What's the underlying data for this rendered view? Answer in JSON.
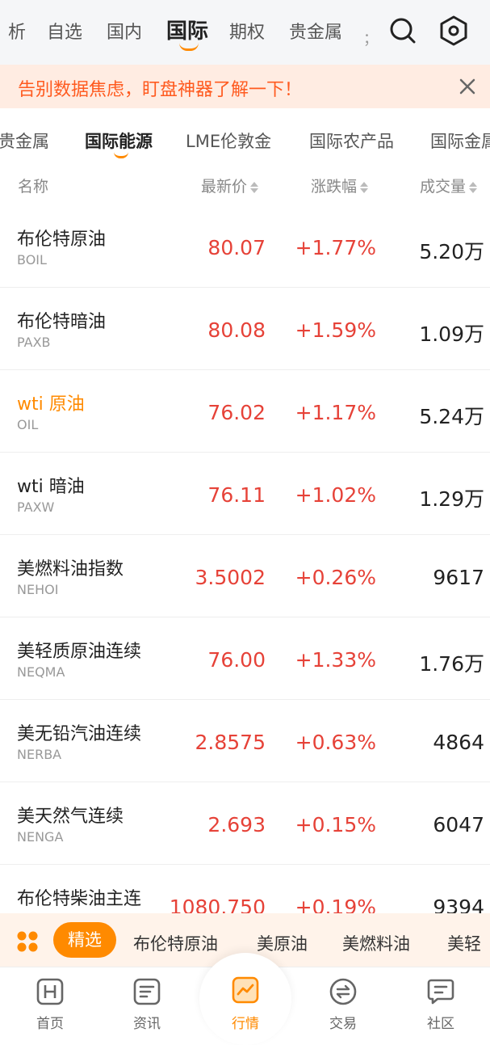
{
  "top_nav": {
    "tabs": [
      "析",
      "自选",
      "国内",
      "国际",
      "期权",
      "贵金属",
      "；"
    ],
    "active_tab": "国际"
  },
  "banner": {
    "text": "告别数据焦虑，盯盘神器了解一下！"
  },
  "sub_tabs": {
    "items": [
      "贵金属",
      "国际能源",
      "LME伦敦金",
      "国际农产品",
      "国际金属"
    ],
    "active": "国际能源"
  },
  "table": {
    "headers": {
      "name": "名称",
      "price": "最新价",
      "change": "涨跌幅",
      "volume": "成交量"
    },
    "rows": [
      {
        "name": "布伦特原油",
        "code": "BOIL",
        "price": "80.07",
        "change": "+1.77%",
        "volume": "5.20万"
      },
      {
        "name": "布伦特暗油",
        "code": "PAXB",
        "price": "80.08",
        "change": "+1.59%",
        "volume": "1.09万"
      },
      {
        "name": "wti 原油",
        "code": "OIL",
        "price": "76.02",
        "change": "+1.17%",
        "volume": "5.24万"
      },
      {
        "name": "wti 暗油",
        "code": "PAXW",
        "price": "76.11",
        "change": "+1.02%",
        "volume": "1.29万"
      },
      {
        "name": "美燃料油指数",
        "code": "NEHOI",
        "price": "3.5002",
        "change": "+0.26%",
        "volume": "9617"
      },
      {
        "name": "美轻质原油连续",
        "code": "NEQMA",
        "price": "76.00",
        "change": "+1.33%",
        "volume": "1.76万"
      },
      {
        "name": "美无铅汽油连续",
        "code": "NERBA",
        "price": "2.8575",
        "change": "+0.63%",
        "volume": "4864"
      },
      {
        "name": "美天然气连续",
        "code": "NENGA",
        "price": "2.693",
        "change": "+0.15%",
        "volume": "6047"
      },
      {
        "name": "布伦特柴油主连",
        "code": "",
        "price": "1080.750",
        "change": "+0.19%",
        "volume": "9394"
      }
    ]
  },
  "quick_bar": {
    "selected": "精选",
    "items": [
      "布伦特原油",
      "美原油",
      "美燃料油",
      "美轻"
    ]
  },
  "bottom_nav": {
    "items": [
      "首页",
      "资讯",
      "行情",
      "交易",
      "社区"
    ],
    "active": "行情"
  },
  "colors": {
    "accent": "#ff8a00",
    "up": "#e64238",
    "banner_bg": "#ffece2",
    "banner_text": "#ff5a1f"
  }
}
